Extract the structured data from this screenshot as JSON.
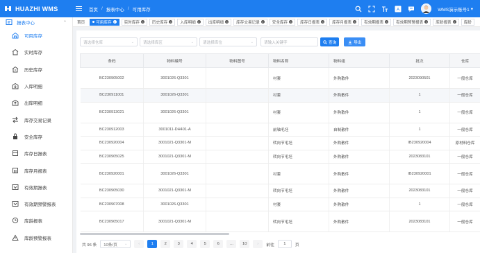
{
  "app": {
    "logo_text": "HUAZHI WMS"
  },
  "breadcrumb": [
    "首页",
    "报表中心",
    "可用库存"
  ],
  "user": {
    "name": "WMS演示账号1"
  },
  "sidebar": {
    "section": "报表中心",
    "items": [
      {
        "label": "可用库存",
        "icon": "warehouse-icon"
      },
      {
        "label": "实时库存",
        "icon": "house-icon"
      },
      {
        "label": "历史库存",
        "icon": "history-house-icon"
      },
      {
        "label": "入库明细",
        "icon": "inbound-icon"
      },
      {
        "label": "出库明细",
        "icon": "outbound-icon"
      },
      {
        "label": "库存交易记录",
        "icon": "transfer-icon"
      },
      {
        "label": "安全库存",
        "icon": "safe-stock-icon"
      },
      {
        "label": "库存日报表",
        "icon": "daily-report-icon"
      },
      {
        "label": "库存月报表",
        "icon": "monthly-report-icon"
      },
      {
        "label": "有效期报表",
        "icon": "expiry-report-icon"
      },
      {
        "label": "有效期预警报表",
        "icon": "expiry-alert-icon"
      },
      {
        "label": "库龄报表",
        "icon": "stock-age-icon"
      },
      {
        "label": "库龄预警报表",
        "icon": "stock-age-alert-icon"
      }
    ]
  },
  "tabs": [
    "首页",
    "可用库存",
    "实时库存",
    "历史库存",
    "入库明细",
    "出库明细",
    "库存交易记录",
    "安全库存",
    "库存日报表",
    "库存月报表",
    "有效期报表",
    "有效期预警报表",
    "库龄报表",
    "库龄"
  ],
  "filters": {
    "warehouse_placeholder": "请选择仓库",
    "zone_placeholder": "请选择库区",
    "location_placeholder": "请选择库位",
    "keyword_placeholder": "请输入关键字",
    "query_label": "查询",
    "export_label": "导出"
  },
  "table": {
    "columns": [
      "条码",
      "物料编号",
      "物料图号",
      "物料名称",
      "物料组",
      "批次",
      "仓库"
    ],
    "rows": [
      [
        "BC230905002",
        "3001026-Q3301",
        "",
        "衬套",
        "外购散件",
        "2023090501",
        "一般仓库"
      ],
      [
        "BC230911001",
        "3001026-Q3301",
        "",
        "衬套",
        "外购散件",
        "1",
        "一般仓库"
      ],
      [
        "BC230913021",
        "3001026-Q3301",
        "",
        "衬套",
        "外购散件",
        "1",
        "一般仓库"
      ],
      [
        "BC230912003",
        "3001011-DH401-A",
        "",
        "前轴毛坯",
        "自制散件",
        "1",
        "一般仓库"
      ],
      [
        "BC230920004",
        "3001021-Q3301-M",
        "",
        "转向节毛坯",
        "外购散件",
        "IB230920004",
        "原材料仓库"
      ],
      [
        "BC230905025",
        "3001021-Q3301-M",
        "",
        "转向节毛坯",
        "外购散件",
        "2023083101",
        "一般仓库"
      ],
      [
        "BC230920001",
        "3001026-Q3301",
        "",
        "衬套",
        "外购散件",
        "IB230920001",
        "一般仓库"
      ],
      [
        "BC230905030",
        "3001021-Q3301-M",
        "",
        "转向节毛坯",
        "外购散件",
        "2023083101",
        "一般仓库"
      ],
      [
        "BC230907008",
        "3001026-Q3301",
        "",
        "衬套",
        "外购散件",
        "1",
        "一般仓库"
      ],
      [
        "BC230905017",
        "3001021-Q3301-M",
        "",
        "转向节毛坯",
        "外购散件",
        "2023083101",
        "一般仓库"
      ]
    ]
  },
  "pagination": {
    "total": "共 96 条",
    "page_size": "10条/页",
    "pages": [
      "1",
      "2",
      "3",
      "4",
      "5",
      "6",
      "…",
      "10"
    ],
    "current": "1",
    "goto_label": "前往",
    "goto_value": "1",
    "page_suffix": "页"
  },
  "colors": {
    "accent": "#1e7ef0"
  }
}
